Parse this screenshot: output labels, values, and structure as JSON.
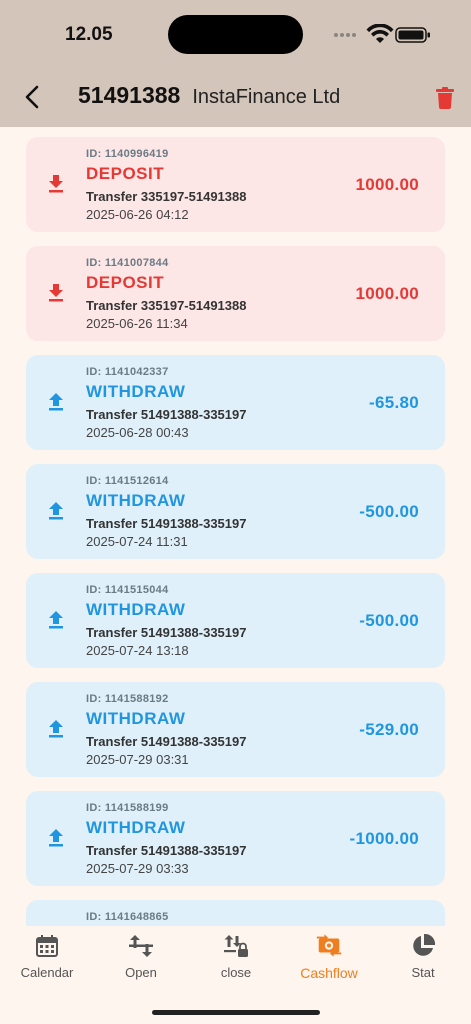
{
  "status_bar": {
    "time": "12.05"
  },
  "header": {
    "account": "51491388",
    "broker": "InstaFinance Ltd"
  },
  "colors": {
    "deposit": "#e53935",
    "withdraw": "#2196e0",
    "active_tab": "#f07e1e"
  },
  "transactions": [
    {
      "kind": "deposit",
      "id": "ID: 1140996419",
      "type": "DEPOSIT",
      "desc": "Transfer 335197-51491388",
      "date": "2025-06-26 04:12",
      "amount": "1000.00"
    },
    {
      "kind": "deposit",
      "id": "ID: 1141007844",
      "type": "DEPOSIT",
      "desc": "Transfer 335197-51491388",
      "date": "2025-06-26 11:34",
      "amount": "1000.00"
    },
    {
      "kind": "withdraw",
      "id": "ID: 1141042337",
      "type": "WITHDRAW",
      "desc": "Transfer 51491388-335197",
      "date": "2025-06-28 00:43",
      "amount": "-65.80"
    },
    {
      "kind": "withdraw",
      "id": "ID: 1141512614",
      "type": "WITHDRAW",
      "desc": "Transfer 51491388-335197",
      "date": "2025-07-24 11:31",
      "amount": "-500.00"
    },
    {
      "kind": "withdraw",
      "id": "ID: 1141515044",
      "type": "WITHDRAW",
      "desc": "Transfer 51491388-335197",
      "date": "2025-07-24 13:18",
      "amount": "-500.00"
    },
    {
      "kind": "withdraw",
      "id": "ID: 1141588192",
      "type": "WITHDRAW",
      "desc": "Transfer 51491388-335197",
      "date": "2025-07-29 03:31",
      "amount": "-529.00"
    },
    {
      "kind": "withdraw",
      "id": "ID: 1141588199",
      "type": "WITHDRAW",
      "desc": "Transfer 51491388-335197",
      "date": "2025-07-29 03:33",
      "amount": "-1000.00"
    },
    {
      "kind": "withdraw",
      "id": "ID: 1141648865",
      "type": "",
      "desc": "",
      "date": "",
      "amount": ""
    }
  ],
  "nav": [
    {
      "label": "Calendar",
      "icon": "calendar-icon"
    },
    {
      "label": "Open",
      "icon": "swap-vertical-icon"
    },
    {
      "label": "close",
      "icon": "swap-lock-icon"
    },
    {
      "label": "Cashflow",
      "icon": "cash-exchange-icon",
      "active": true
    },
    {
      "label": "Stat",
      "icon": "pie-chart-icon"
    }
  ]
}
